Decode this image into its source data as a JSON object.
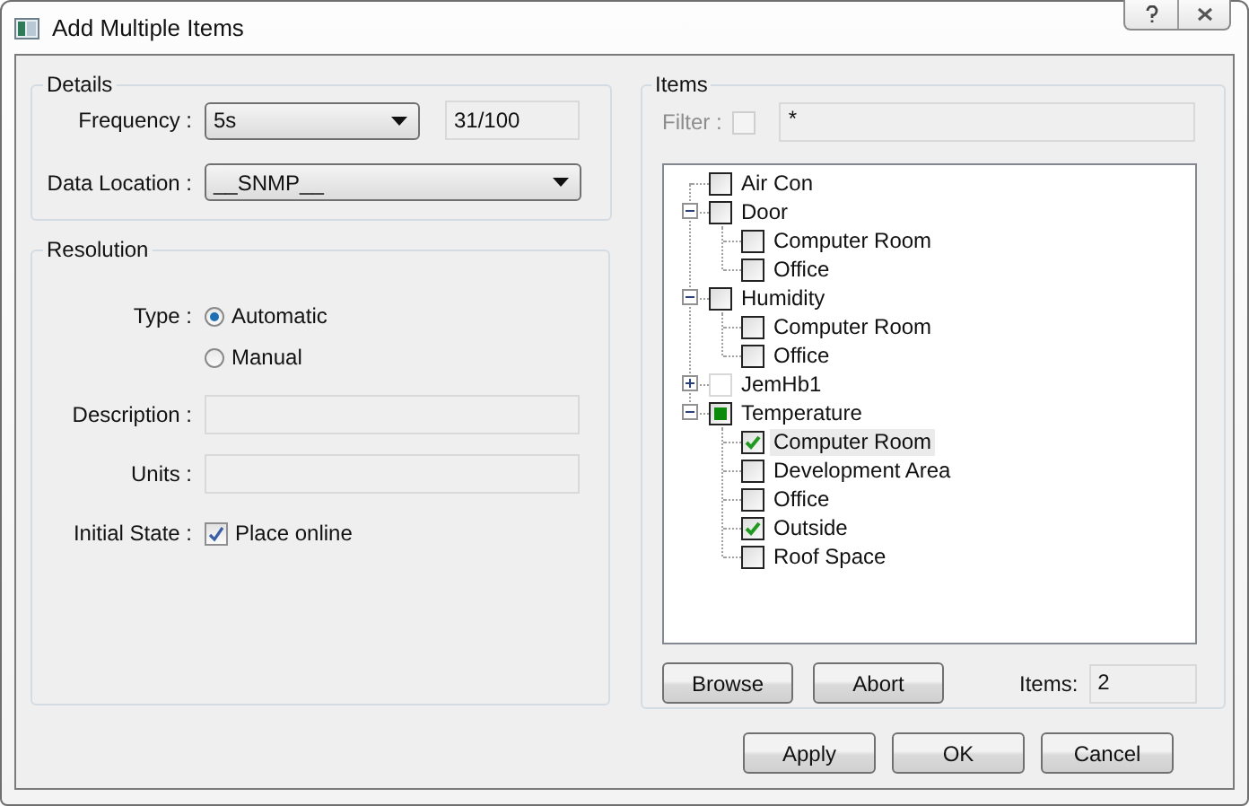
{
  "window": {
    "title": "Add Multiple Items"
  },
  "details": {
    "legend": "Details",
    "frequency": {
      "label": "Frequency :",
      "value": "5s",
      "counter": "31/100"
    },
    "data_location": {
      "label": "Data Location :",
      "value": "__SNMP__"
    }
  },
  "resolution": {
    "legend": "Resolution",
    "type": {
      "label": "Type :",
      "options": [
        {
          "label": "Automatic",
          "selected": true
        },
        {
          "label": "Manual",
          "selected": false
        }
      ]
    },
    "description": {
      "label": "Description :"
    },
    "units": {
      "label": "Units :"
    },
    "initial_state": {
      "label": "Initial State :",
      "option": "Place online",
      "checked": true
    }
  },
  "items": {
    "legend": "Items",
    "filter": {
      "label": "Filter :",
      "checked": false,
      "disabled": true,
      "value": "*"
    },
    "tree": [
      {
        "label": "Air Con",
        "checked": false,
        "partial": false,
        "disabled": false,
        "selected": false
      },
      {
        "label": "Door",
        "checked": false,
        "partial": false,
        "disabled": false,
        "selected": false,
        "expanded": true,
        "children": [
          {
            "label": "Computer Room",
            "checked": false,
            "disabled": false,
            "selected": false
          },
          {
            "label": "Office",
            "checked": false,
            "disabled": false,
            "selected": false
          }
        ]
      },
      {
        "label": "Humidity",
        "checked": false,
        "partial": false,
        "disabled": false,
        "selected": false,
        "expanded": true,
        "children": [
          {
            "label": "Computer Room",
            "checked": false,
            "disabled": false,
            "selected": false
          },
          {
            "label": "Office",
            "checked": false,
            "disabled": false,
            "selected": false
          }
        ]
      },
      {
        "label": "JemHb1",
        "checked": false,
        "partial": false,
        "disabled": true,
        "selected": false,
        "expanded": false
      },
      {
        "label": "Temperature",
        "checked": false,
        "partial": true,
        "disabled": false,
        "selected": false,
        "expanded": true,
        "children": [
          {
            "label": "Computer Room",
            "checked": true,
            "disabled": false,
            "selected": true
          },
          {
            "label": "Development Area",
            "checked": false,
            "disabled": false,
            "selected": false
          },
          {
            "label": "Office",
            "checked": false,
            "disabled": false,
            "selected": false
          },
          {
            "label": "Outside",
            "checked": true,
            "disabled": false,
            "selected": false
          },
          {
            "label": "Roof Space",
            "checked": false,
            "disabled": false,
            "selected": false
          }
        ]
      }
    ],
    "buttons": [
      "Browse",
      "Abort"
    ],
    "count": {
      "label": "Items:",
      "value": "2"
    }
  },
  "buttons": [
    "Apply",
    "OK",
    "Cancel"
  ]
}
